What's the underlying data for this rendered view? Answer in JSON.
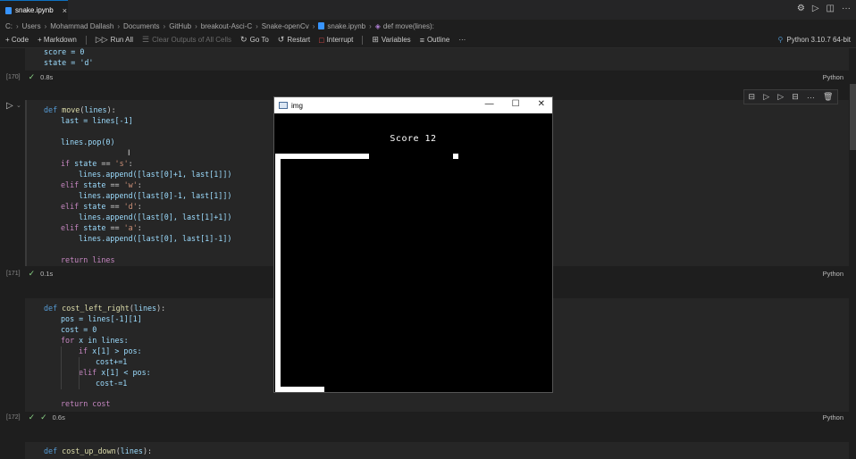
{
  "tab": {
    "name": "snake.ipynb"
  },
  "breadcrumb": [
    "C:",
    "Users",
    "Mohammad Dallash",
    "Documents",
    "GitHub",
    "breakout-Asci-C",
    "Snake-openCv",
    "snake.ipynb",
    "def move(lines):"
  ],
  "toolbar": {
    "code": "+ Code",
    "markdown": "+ Markdown",
    "run_all": "Run All",
    "clear": "Clear Outputs of All Cells",
    "goto": "Go To",
    "restart": "Restart",
    "interrupt": "Interrupt",
    "variables": "Variables",
    "outline": "Outline",
    "more": "···"
  },
  "kernel": "Python 3.10.7 64-bit",
  "cells": {
    "c170": {
      "num": "[170]",
      "time": "0.8s",
      "lang": "Python"
    },
    "c171": {
      "num": "[171]",
      "time": "0.1s",
      "lang": "Python"
    },
    "c172": {
      "num": "[172]",
      "time": "0.6s",
      "lang": "Python"
    }
  },
  "code": {
    "top1": "score = 0",
    "top2": "state = 'd'",
    "move_def": "move",
    "move_param": "lines",
    "last_line": "last = lines[-1]",
    "pop_line": "lines.pop(0)",
    "if_s": "'s'",
    "elif_w": "'w'",
    "elif_d": "'d'",
    "elif_a": "'a'",
    "app1": "lines.append([last[0]+1, last[1]])",
    "app2": "lines.append([last[0]-1, last[1]])",
    "app3": "lines.append([last[0], last[1]+1])",
    "app4": "lines.append([last[0], last[1]-1])",
    "ret_lines": "return lines",
    "clr_def": "cost_left_right",
    "clr_pos": "pos = lines[-1][1]",
    "clr_cost": "cost = 0",
    "clr_for": "x in lines:",
    "clr_if": "x[1] > pos:",
    "clr_inc": "cost+=1",
    "clr_elif": "x[1] < pos:",
    "clr_dec": "cost-=1",
    "clr_ret": "return cost",
    "cud_def": "cost_up_down"
  },
  "window": {
    "title": "img",
    "score": "Score 12"
  }
}
